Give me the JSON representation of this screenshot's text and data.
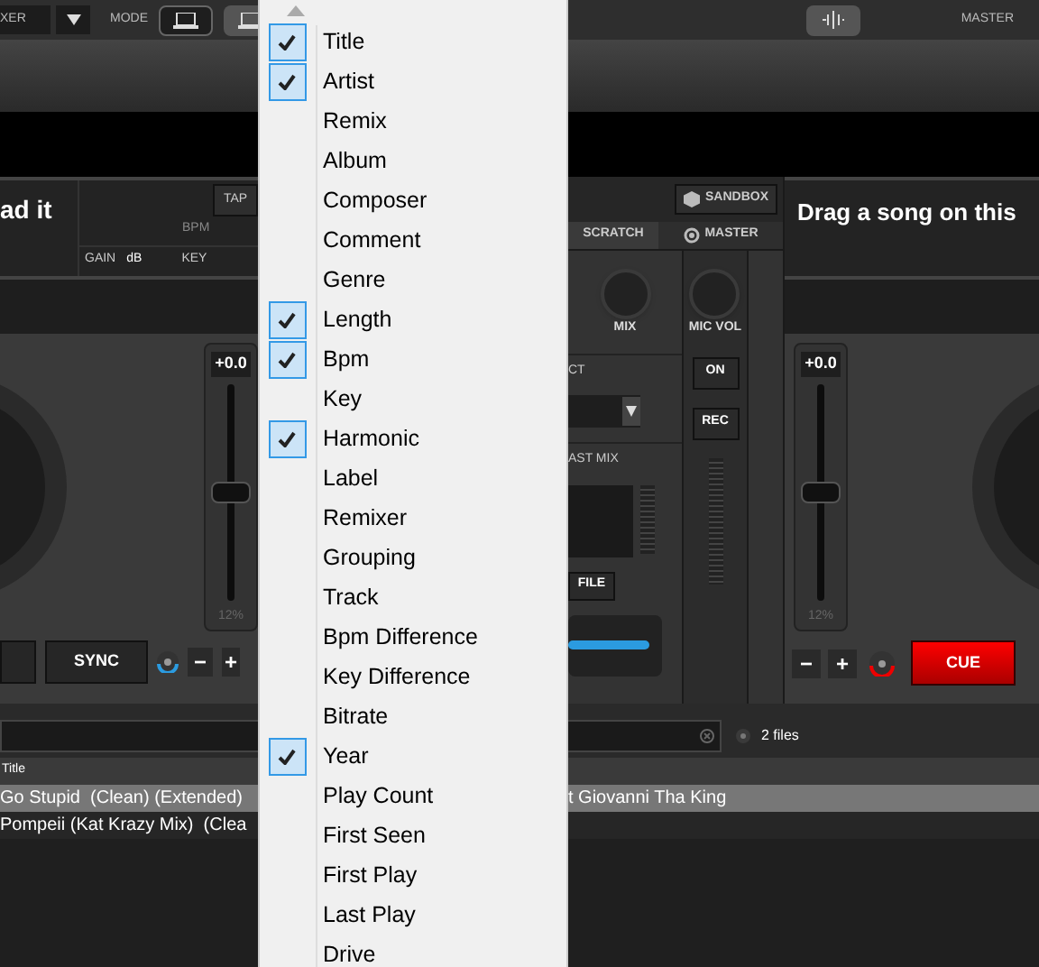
{
  "toolbar": {
    "mixer_label": "XER",
    "mode_label": "MODE",
    "mode_buttons": [
      {
        "selected": true
      },
      {
        "selected": false
      }
    ],
    "master_label": "MASTER"
  },
  "deck_left": {
    "title": "ad it",
    "tap": "TAP",
    "bpm_label": "BPM",
    "gain_label": "GAIN",
    "gain_unit": "dB",
    "key_label": "KEY",
    "pitch": "+0.0",
    "pitch_slider": {
      "level": 0.5
    },
    "pitch_range": "12%",
    "sync": "SYNC",
    "minus": "−",
    "plus": "+"
  },
  "mixer": {
    "sandbox": "SANDBOX",
    "tabs": [
      {
        "label": "SCRATCH"
      },
      {
        "label": "MASTER"
      }
    ],
    "mix_label": "MIX",
    "mic_vol_label": "MIC VOL",
    "on": "ON",
    "rec": "REC",
    "effect_label": "CT",
    "broadcast_label": "AST MIX",
    "file": "FILE"
  },
  "deck_right": {
    "title": "Drag a song on this",
    "pitch": "+0.0",
    "pitch_slider": {
      "level": 0.5
    },
    "pitch_range": "12%",
    "minus": "−",
    "plus": "+",
    "cue": "CUE"
  },
  "browser": {
    "file_count": "2 files",
    "columns": [
      "Title"
    ],
    "rows": [
      {
        "title": "Go Stupid  (Clean) (Extended)",
        "column_2": "t Giovanni Tha King",
        "selected": true
      },
      {
        "title": "Pompeii (Kat Krazy Mix)  (Clea",
        "selected": false
      }
    ]
  },
  "column_menu": {
    "items": [
      {
        "label": "Title",
        "checked": true
      },
      {
        "label": "Artist",
        "checked": true
      },
      {
        "label": "Remix",
        "checked": false
      },
      {
        "label": "Album",
        "checked": false
      },
      {
        "label": "Composer",
        "checked": false
      },
      {
        "label": "Comment",
        "checked": false
      },
      {
        "label": "Genre",
        "checked": false
      },
      {
        "label": "Length",
        "checked": true
      },
      {
        "label": "Bpm",
        "checked": true
      },
      {
        "label": "Key",
        "checked": false
      },
      {
        "label": "Harmonic",
        "checked": true
      },
      {
        "label": "Label",
        "checked": false
      },
      {
        "label": "Remixer",
        "checked": false
      },
      {
        "label": "Grouping",
        "checked": false
      },
      {
        "label": "Track",
        "checked": false
      },
      {
        "label": "Bpm Difference",
        "checked": false
      },
      {
        "label": "Key Difference",
        "checked": false
      },
      {
        "label": "Bitrate",
        "checked": false
      },
      {
        "label": "Year",
        "checked": true
      },
      {
        "label": "Play Count",
        "checked": false
      },
      {
        "label": "First Seen",
        "checked": false
      },
      {
        "label": "First Play",
        "checked": false
      },
      {
        "label": "Last Play",
        "checked": false
      },
      {
        "label": "Drive",
        "checked": false
      }
    ]
  }
}
